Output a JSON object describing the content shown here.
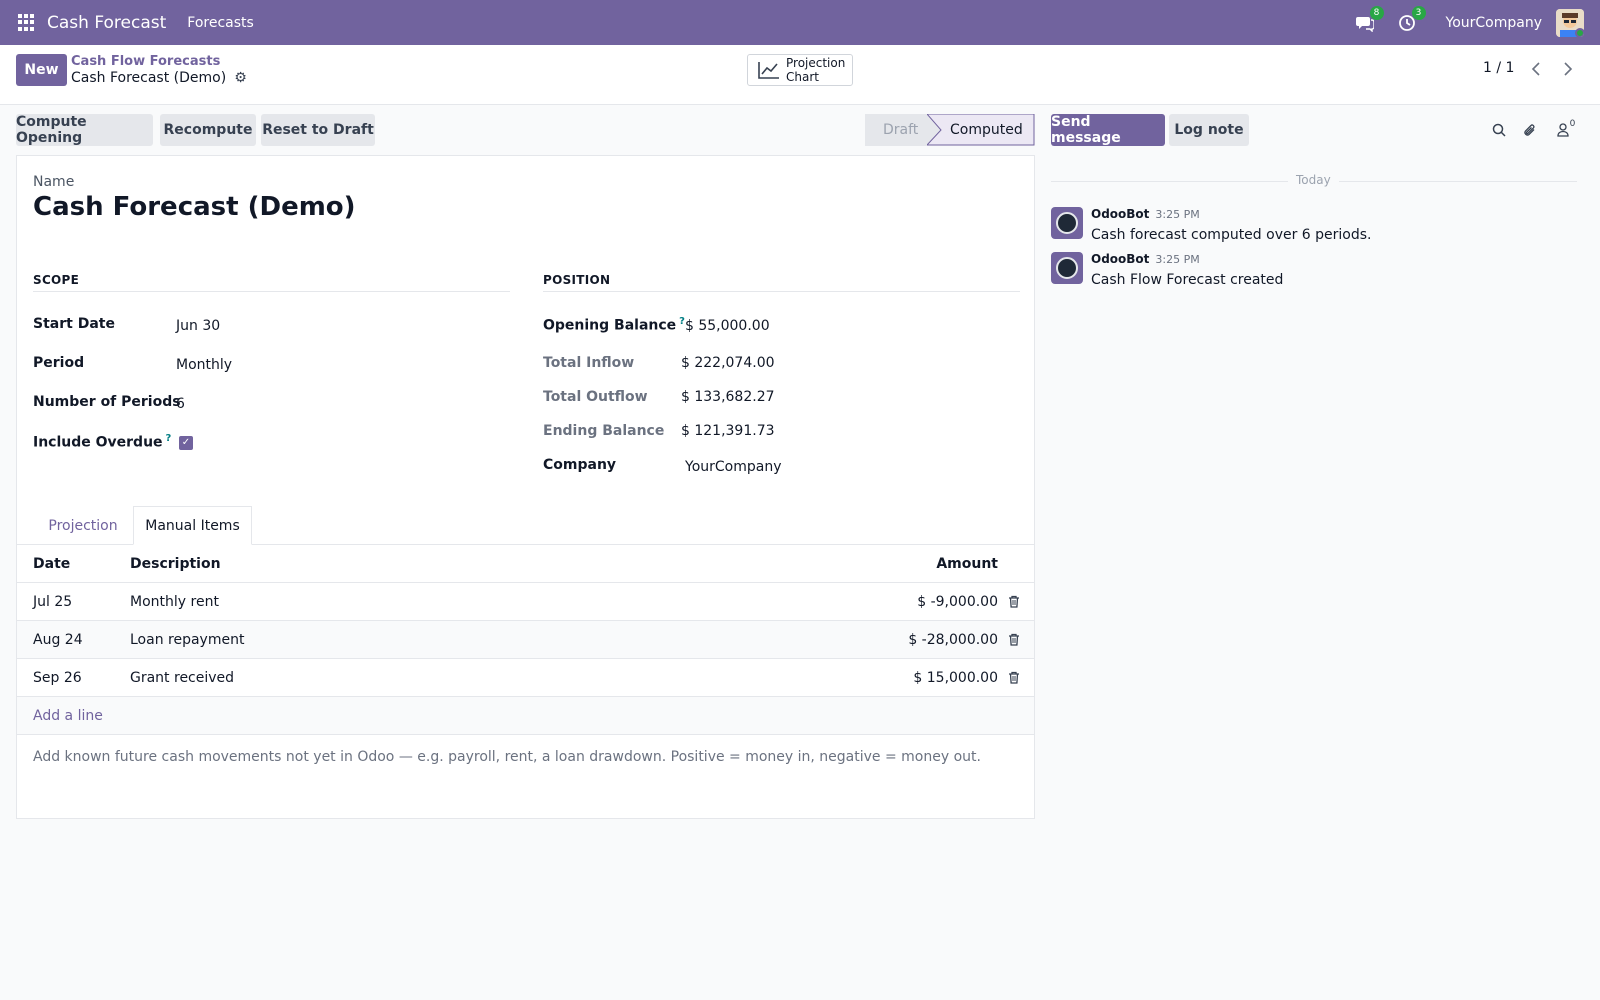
{
  "navbar": {
    "app_name": "Cash Forecast",
    "menu_forecasts": "Forecasts",
    "messages_count": "8",
    "activities_count": "3",
    "company": "YourCompany"
  },
  "control_panel": {
    "new_label": "New",
    "breadcrumb_parent": "Cash Flow Forecasts",
    "breadcrumb_current": "Cash Forecast (Demo)",
    "projection_chart_line1": "Projection",
    "projection_chart_line2": "Chart",
    "pager": "1 / 1"
  },
  "statusbar": {
    "compute_opening": "Compute Opening",
    "recompute": "Recompute",
    "reset_to_draft": "Reset to Draft",
    "stage_draft": "Draft",
    "stage_computed": "Computed",
    "active_stage": "Computed"
  },
  "form": {
    "name_label": "Name",
    "name_value": "Cash Forecast (Demo)",
    "scope": {
      "title": "SCOPE",
      "start_date_label": "Start Date",
      "start_date": "Jun 30",
      "period_label": "Period",
      "period": "Monthly",
      "num_periods_label": "Number of Periods",
      "num_periods": "6",
      "include_overdue_label": "Include Overdue",
      "include_overdue": true
    },
    "position": {
      "title": "POSITION",
      "opening_balance_label": "Opening Balance",
      "opening_balance": "$ 55,000.00",
      "total_inflow_label": "Total Inflow",
      "total_inflow": "$ 222,074.00",
      "total_outflow_label": "Total Outflow",
      "total_outflow": "$ 133,682.27",
      "ending_balance_label": "Ending Balance",
      "ending_balance": "$ 121,391.73",
      "company_label": "Company",
      "company": "YourCompany"
    },
    "help_mark": "?"
  },
  "tabs": {
    "projection": "Projection",
    "manual_items": "Manual Items",
    "active": "Manual Items"
  },
  "manual_items": {
    "columns": {
      "date": "Date",
      "description": "Description",
      "amount": "Amount"
    },
    "rows": [
      {
        "date": "Jul 25",
        "description": "Monthly rent",
        "amount": "$ -9,000.00"
      },
      {
        "date": "Aug 24",
        "description": "Loan repayment",
        "amount": "$ -28,000.00"
      },
      {
        "date": "Sep 26",
        "description": "Grant received",
        "amount": "$ 15,000.00"
      }
    ],
    "add_line": "Add a line",
    "note": "Add known future cash movements not yet in Odoo — e.g. payroll, rent, a loan drawdown. Positive = money in, negative = money out."
  },
  "chatter": {
    "send_message": "Send message",
    "log_note": "Log note",
    "followers_count": "0",
    "date_separator": "Today",
    "messages": [
      {
        "author": "OdooBot",
        "time": "3:25 PM",
        "body": "Cash forecast computed over 6 periods."
      },
      {
        "author": "OdooBot",
        "time": "3:25 PM",
        "body": "Cash Flow Forecast created"
      }
    ]
  },
  "colors": {
    "brand": "#71639e",
    "badge": "#28a745",
    "help": "#017e84"
  }
}
